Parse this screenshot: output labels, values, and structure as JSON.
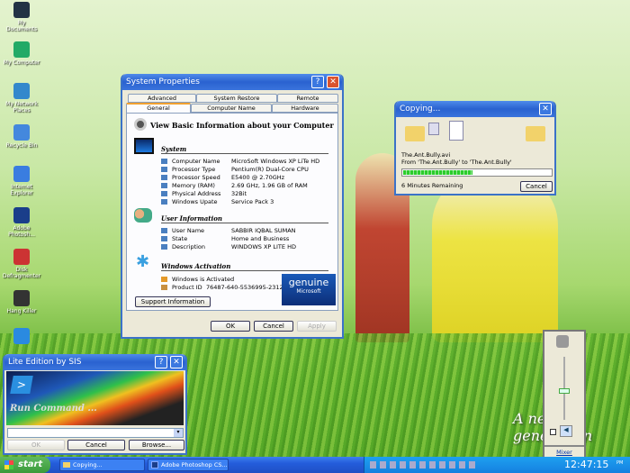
{
  "desktop": {
    "icons": [
      {
        "label": "My Documents",
        "icon": "documents-icon"
      },
      {
        "label": "My Computer",
        "icon": "computer-icon"
      },
      {
        "label": "My Network Places",
        "icon": "network-icon"
      },
      {
        "label": "Recycle Bin",
        "icon": "recycle-bin-icon"
      },
      {
        "label": "Internet Explorer",
        "icon": "ie-icon"
      },
      {
        "label": "Adobe Photosh...",
        "icon": "photoshop-icon"
      },
      {
        "label": "Disk Defragmenter",
        "icon": "defrag-icon"
      },
      {
        "label": "Hang Killer",
        "icon": "hang-killer-icon"
      },
      {
        "label": "",
        "icon": "refresh-icon"
      }
    ],
    "wallpaper_text": "A new generation"
  },
  "sysprops": {
    "title": "System Properties",
    "tabs_back": [
      "Advanced",
      "System Restore",
      "Remote"
    ],
    "tabs_front": [
      "General",
      "Computer Name",
      "Hardware"
    ],
    "active_tab": "General",
    "heading": "View Basic Information about your Computer",
    "system_title": "System",
    "system": [
      {
        "k": "Computer Name",
        "v": "MicroSoft Windows XP LiTe HD"
      },
      {
        "k": "Processor Type",
        "v": "Pentium(R) Dual-Core  CPU"
      },
      {
        "k": "Processor Speed",
        "v": "E5400  @ 2.70GHz"
      },
      {
        "k": "Memory (RAM)",
        "v": "2.69 GHz, 1.96 GB of RAM"
      },
      {
        "k": "Physical Address",
        "v": "32Bit"
      },
      {
        "k": "Windows Upate",
        "v": "Service Pack 3"
      }
    ],
    "user_title": "User Information",
    "user": [
      {
        "k": "User Name",
        "v": "SABBIR IQBAL SUMAN"
      },
      {
        "k": "State",
        "v": "Home and Business"
      },
      {
        "k": "Description",
        "v": "WINDOWS XP LITE HD"
      }
    ],
    "activation_title": "Windows Activation",
    "activated": "Windows is Activated",
    "product_label": "Product ID",
    "product_id": "76487-640-5536995-23126",
    "genuine": "genuine",
    "genuine_sub": "Microsoft",
    "support": "Support Information",
    "ok": "OK",
    "cancel": "Cancel",
    "apply": "Apply"
  },
  "copy": {
    "title": "Copying...",
    "file": "The.Ant.Bully.avi",
    "from": "From 'The.Ant.Bully' to 'The.Ant.Bully'",
    "progress": 0.47,
    "remaining": "6 Minutes Remaining",
    "cancel": "Cancel"
  },
  "run": {
    "title": "Lite Edition by SIS",
    "banner": "Run Command ...",
    "value": "",
    "ok": "OK",
    "cancel": "Cancel",
    "browse": "Browse..."
  },
  "volume": {
    "level": 0.45,
    "muted": false,
    "mixer": "Mixer"
  },
  "taskbar": {
    "start": "start",
    "tasks": [
      "Copying...",
      "Adobe Photoshop CS..."
    ],
    "clock": "12:47:15",
    "ampm": "PM"
  }
}
